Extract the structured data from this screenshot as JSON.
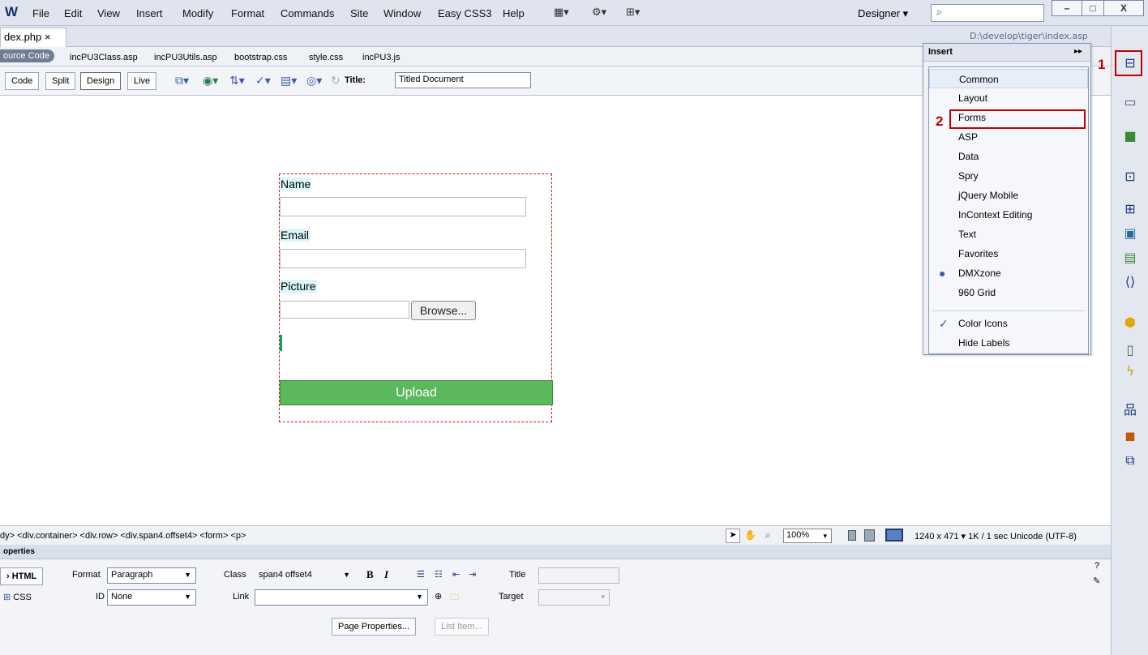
{
  "app": {
    "logo": "W"
  },
  "menu": [
    "File",
    "Edit",
    "View",
    "Insert",
    "Modify",
    "Format",
    "Commands",
    "Site",
    "Window",
    "Easy CSS3",
    "Help"
  ],
  "toolbar_icons": [
    "layout-icon",
    "gear-icon",
    "site-icon"
  ],
  "workspace": {
    "label": "Designer",
    "caret": "▾"
  },
  "search": {
    "glyph": "⌕",
    "placeholder": ""
  },
  "window_controls": [
    "–",
    "□",
    "X"
  ],
  "doc_tab": {
    "label": "dex.php",
    "close": "×"
  },
  "doc_path": "D:\\develop\\tiger\\index.asp",
  "related_files": {
    "source": "ource Code",
    "files": [
      "incPU3Class.asp",
      "incPU3Utils.asp",
      "bootstrap.css",
      "style.css",
      "incPU3.js"
    ]
  },
  "view_buttons": [
    "Code",
    "Split",
    "Design",
    "Live"
  ],
  "title_field": {
    "label": "Title:",
    "value": "Titled Document"
  },
  "form": {
    "name_label": "Name",
    "email_label": "Email",
    "picture_label": "Picture",
    "browse": "Browse...",
    "upload": "Upload"
  },
  "tag_selector": "dy> <div.container> <div.row> <div.span4.offset4> <form> <p>",
  "zoom": "100%",
  "size_info": "1240 x 471 ▾  1K / 1 sec  Unicode (UTF-8)",
  "properties": {
    "bar_label": "operties",
    "html_btn": "HTML",
    "css_btn": "CSS",
    "format_label": "Format",
    "format_value": "Paragraph",
    "id_label": "ID",
    "id_value": "None",
    "class_label": "Class",
    "class_value": "span4 offset4",
    "link_label": "Link",
    "title_label": "Title",
    "target_label": "Target",
    "page_props": "Page Properties...",
    "list_item": "List Item...",
    "bold": "B",
    "italic": "I"
  },
  "insert_panel": {
    "title": "Insert",
    "items": [
      "Common",
      "Layout",
      "Forms",
      "ASP",
      "Data",
      "Spry",
      "jQuery Mobile",
      "InContext Editing",
      "Text",
      "Favorites",
      "DMXzone",
      "960 Grid"
    ],
    "options": [
      "Color Icons",
      "Hide Labels"
    ],
    "marker_1": "1",
    "marker_2": "2"
  }
}
